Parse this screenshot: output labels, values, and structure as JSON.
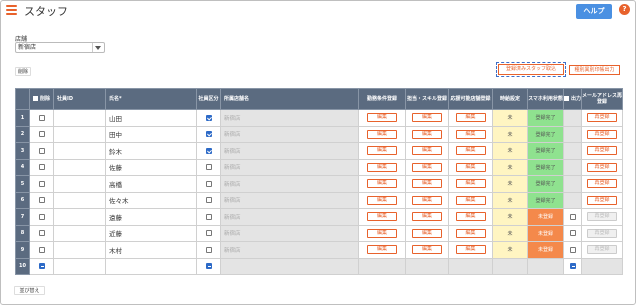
{
  "header": {
    "title": "スタッフ",
    "help_label": "ヘルプ",
    "help_icon_glyph": "?"
  },
  "store": {
    "label": "店舗",
    "selected": "新宿店"
  },
  "actions": {
    "delete_label": "削除",
    "registered_staff_label": "登録済みスタッフ取込",
    "print_label": "種別異別印帳出力",
    "sort_label": "並び替え"
  },
  "table": {
    "headers": {
      "delete": "削除",
      "staff_id": "社員ID",
      "name": "氏名*",
      "employee_type": "社員区分",
      "affiliated_store": "所属店舗名",
      "work_conditions": "勤務条件登録",
      "skills": "担当・スキル登録",
      "store": "応援可能店舗登録",
      "hours": "時給設定",
      "smartphone": "スマホ利用状態",
      "output": "出力",
      "mail": "メールアドレス再登録"
    },
    "edit_label": "編集",
    "reregister_label": "再登録",
    "rows": [
      {
        "no": "1",
        "name": "山田",
        "employee": true,
        "shop": "新宿店",
        "hours": "未",
        "status": "登録完了",
        "status_type": "done",
        "output": false
      },
      {
        "no": "2",
        "name": "田中",
        "employee": true,
        "shop": "新宿店",
        "hours": "未",
        "status": "登録完了",
        "status_type": "done",
        "output": false
      },
      {
        "no": "3",
        "name": "鈴木",
        "employee": true,
        "shop": "新宿店",
        "hours": "未",
        "status": "登録完了",
        "status_type": "done",
        "output": false
      },
      {
        "no": "4",
        "name": "佐藤",
        "employee": false,
        "shop": "新宿店",
        "hours": "未",
        "status": "登録完了",
        "status_type": "done",
        "output": false
      },
      {
        "no": "5",
        "name": "高橋",
        "employee": false,
        "shop": "新宿店",
        "hours": "未",
        "status": "登録完了",
        "status_type": "done",
        "output": false
      },
      {
        "no": "6",
        "name": "佐々木",
        "employee": false,
        "shop": "新宿店",
        "hours": "未",
        "status": "登録完了",
        "status_type": "done",
        "output": false
      },
      {
        "no": "7",
        "name": "遠藤",
        "employee": false,
        "shop": "新宿店",
        "hours": "未",
        "status": "未登録",
        "status_type": "undone",
        "output": true
      },
      {
        "no": "8",
        "name": "近藤",
        "employee": false,
        "shop": "新宿店",
        "hours": "未",
        "status": "未登録",
        "status_type": "undone",
        "output": true
      },
      {
        "no": "9",
        "name": "木村",
        "employee": false,
        "shop": "新宿店",
        "hours": "未",
        "status": "未登録",
        "status_type": "undone",
        "output": true
      },
      {
        "no": "10",
        "name": "",
        "employee": "ind",
        "shop": "",
        "hours": "",
        "status": "",
        "status_type": "empty",
        "output": "ind"
      }
    ]
  },
  "colors": {
    "accent": "#e8622c",
    "primary": "#4a90e2",
    "header_bg": "#5b6b80",
    "done": "#8fe28f",
    "undone": "#f4894b",
    "pending": "#fff5c2"
  }
}
